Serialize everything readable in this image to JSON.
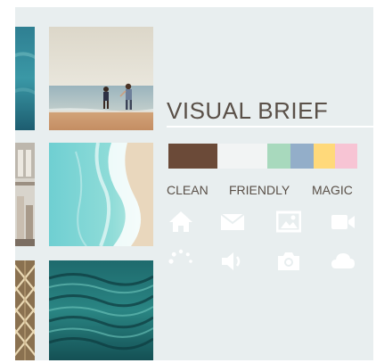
{
  "title": "VISUAL BRIEF",
  "palette": [
    {
      "name": "brown",
      "color": "#6b4a38",
      "flex": 55
    },
    {
      "name": "white",
      "color": "#f2f4f4",
      "flex": 56
    },
    {
      "name": "mint",
      "color": "#a8d9bd",
      "flex": 26
    },
    {
      "name": "blue",
      "color": "#93aec9",
      "flex": 26
    },
    {
      "name": "yellow",
      "color": "#ffd97a",
      "flex": 24
    },
    {
      "name": "pink",
      "color": "#f7c4d4",
      "flex": 25
    }
  ],
  "labels": [
    "CLEAN",
    "FRIENDLY",
    "MAGIC"
  ],
  "icons": [
    "home-icon",
    "envelope-icon",
    "image-icon",
    "video-camera-icon",
    "spinner-icon",
    "speaker-icon",
    "camera-icon",
    "cloud-icon"
  ],
  "colors": {
    "background": "#e8eeef",
    "text": "#5a5048",
    "icon": "#ffffff"
  }
}
